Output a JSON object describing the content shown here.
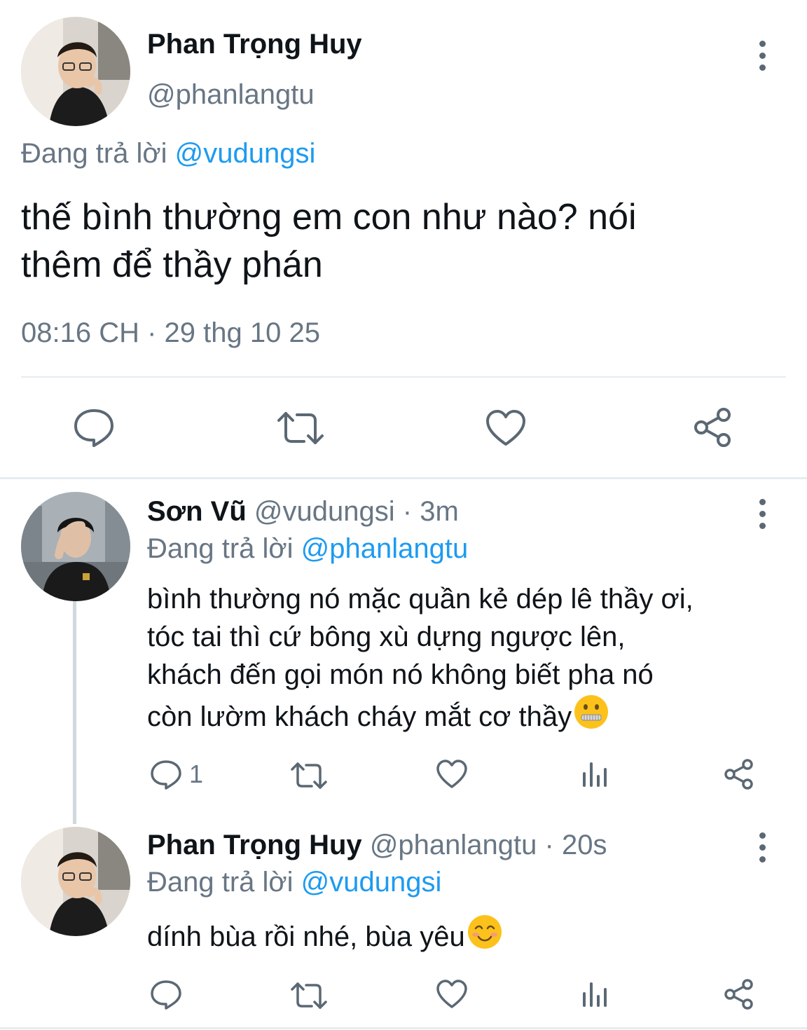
{
  "main_tweet": {
    "display_name": "Phan Trọng Huy",
    "handle": "@phanlangtu",
    "replying_prefix": "Đang trả lời",
    "replying_to": "@vudungsi",
    "text_line1": "thế bình thường em con như nào? nói",
    "text_line2": "thêm để thầy phán",
    "timestamp": "08:16 CH · 29 thg 10 25"
  },
  "replies": [
    {
      "display_name": "Sơn Vũ",
      "handle": "@vudungsi",
      "time": "· 3m",
      "replying_prefix": "Đang trả lời",
      "replying_to": "@phanlangtu",
      "lines": [
        "bình thường nó mặc quần kẻ dép lê thầy ơi,",
        "tóc tai thì cứ bông xù dựng ngược lên,",
        "khách đến gọi món nó không biết pha nó",
        "còn lườm khách cháy mắt cơ thầy"
      ],
      "emoji": "zipper-mouth-face",
      "reply_count": "1"
    },
    {
      "display_name": "Phan Trọng Huy",
      "handle": "@phanlangtu",
      "time": "· 20s",
      "replying_prefix": "Đang trả lời",
      "replying_to": "@vudungsi",
      "lines": [
        "dính bùa rồi nhé, bùa yêu"
      ],
      "emoji": "smiling-face",
      "reply_count": ""
    }
  ],
  "colors": {
    "link": "#1d9bf0",
    "muted": "#687684",
    "icon": "#5b6874",
    "divider": "#e6ecf0"
  },
  "icons": [
    "reply-icon",
    "retweet-icon",
    "like-icon",
    "share-icon",
    "analytics-icon",
    "more-icon"
  ]
}
